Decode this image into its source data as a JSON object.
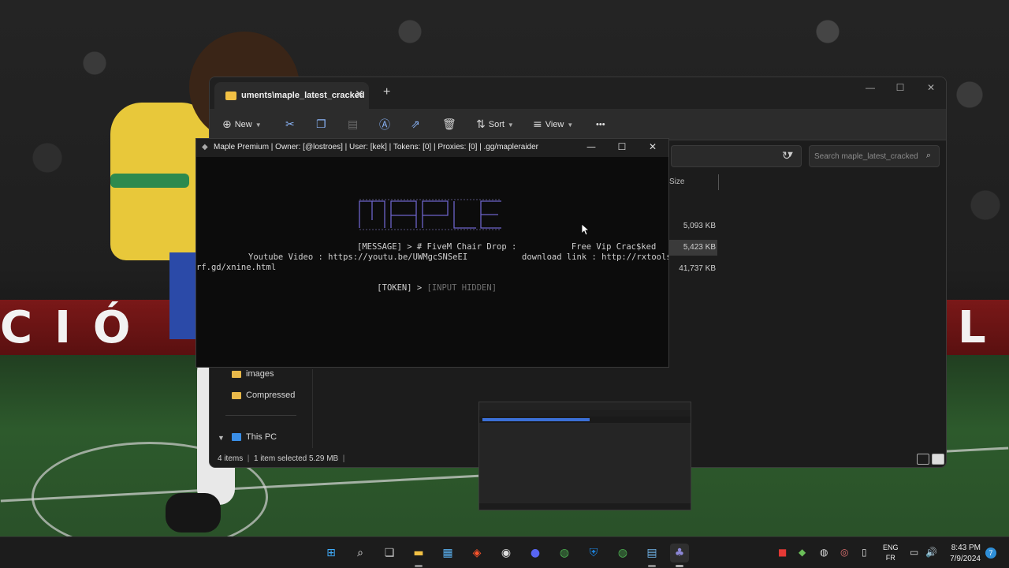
{
  "explorer": {
    "tab_title": "uments\\maple_latest_cracked",
    "toolbar": {
      "new_label": "New",
      "sort_label": "Sort",
      "view_label": "View",
      "more_label": "•••"
    },
    "search_placeholder": "Search maple_latest_cracked",
    "column_size": "Size",
    "sizes": [
      "5,093 KB",
      "5,423 KB",
      "41,737 KB"
    ],
    "sidebar": {
      "images": "images",
      "compressed": "Compressed",
      "this_pc": "This PC"
    },
    "status": {
      "items": "4 items",
      "selected": "1 item selected  5.29 MB"
    }
  },
  "console": {
    "title": "Maple Premium   |  Owner: [@lostroes]  |  User: [kek]  |  Tokens: [0]  |  Proxies: [0]  |  .gg/mapleraider",
    "lines": {
      "message": "[MESSAGE] > # FiveM Chair Drop :           Free Vip Crac$ked",
      "youtube": "Youtube Video : https://youtu.be/UWMgcSNSeEI",
      "download": "download link : http://rxtools.",
      "cont": "rf.gd/xnine.html",
      "token_prefix": "[TOKEN] > ",
      "token_value": "[INPUT HIDDEN]"
    }
  },
  "wallpaper": {
    "banner_left": "CIÓ",
    "banner_right": "L"
  },
  "taskbar": {
    "lang_top": "ENG",
    "lang_bottom": "FR",
    "time": "8:43 PM",
    "date": "7/9/2024",
    "notifications": "7"
  },
  "colors": {
    "folder": "#f2c144",
    "accent": "#3b6fd6",
    "console_bg": "#0c0c0c",
    "explorer_bg": "#1c1c1c"
  }
}
